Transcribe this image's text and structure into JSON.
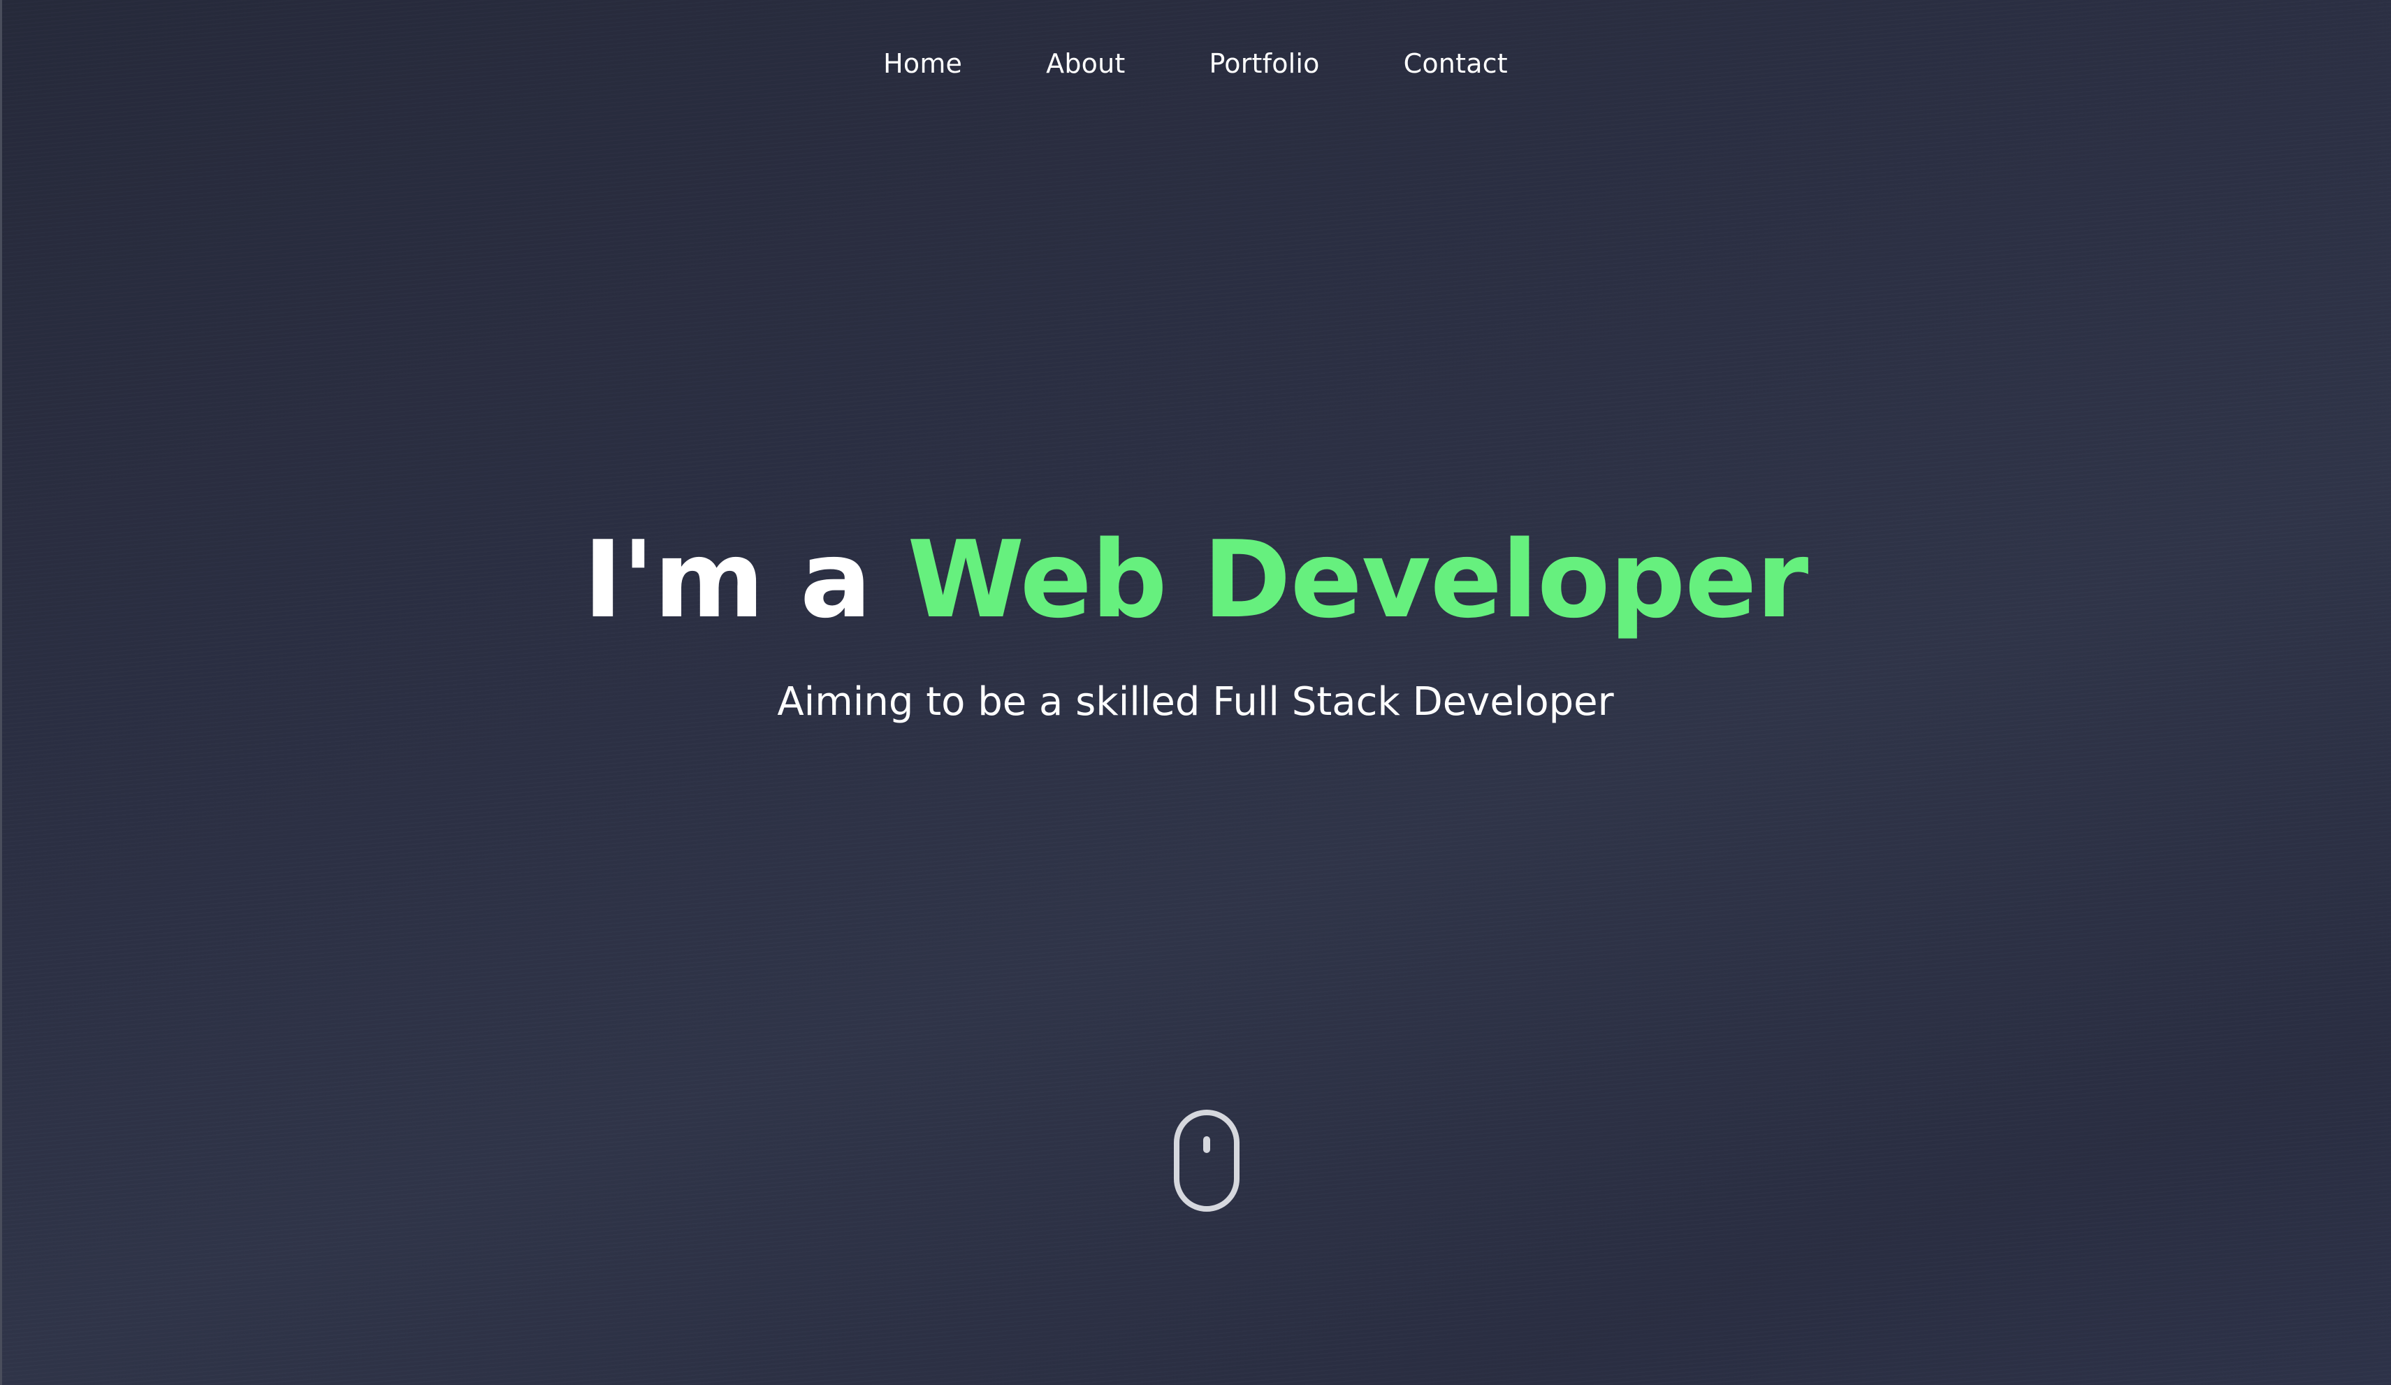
{
  "nav": {
    "items": [
      {
        "label": "Home"
      },
      {
        "label": "About"
      },
      {
        "label": "Portfolio"
      },
      {
        "label": "Contact"
      }
    ]
  },
  "hero": {
    "headline_lead": "I'm a",
    "headline_accent": "Web Developer",
    "subtitle": "Aiming to be a skilled Full Stack Developer"
  },
  "scroll_indicator": {
    "icon": "mouse-scroll-icon"
  },
  "colors": {
    "background": "#2b2f42",
    "accent": "#66f07e",
    "text": "#ffffff",
    "icon_stroke": "#d6d8de"
  }
}
